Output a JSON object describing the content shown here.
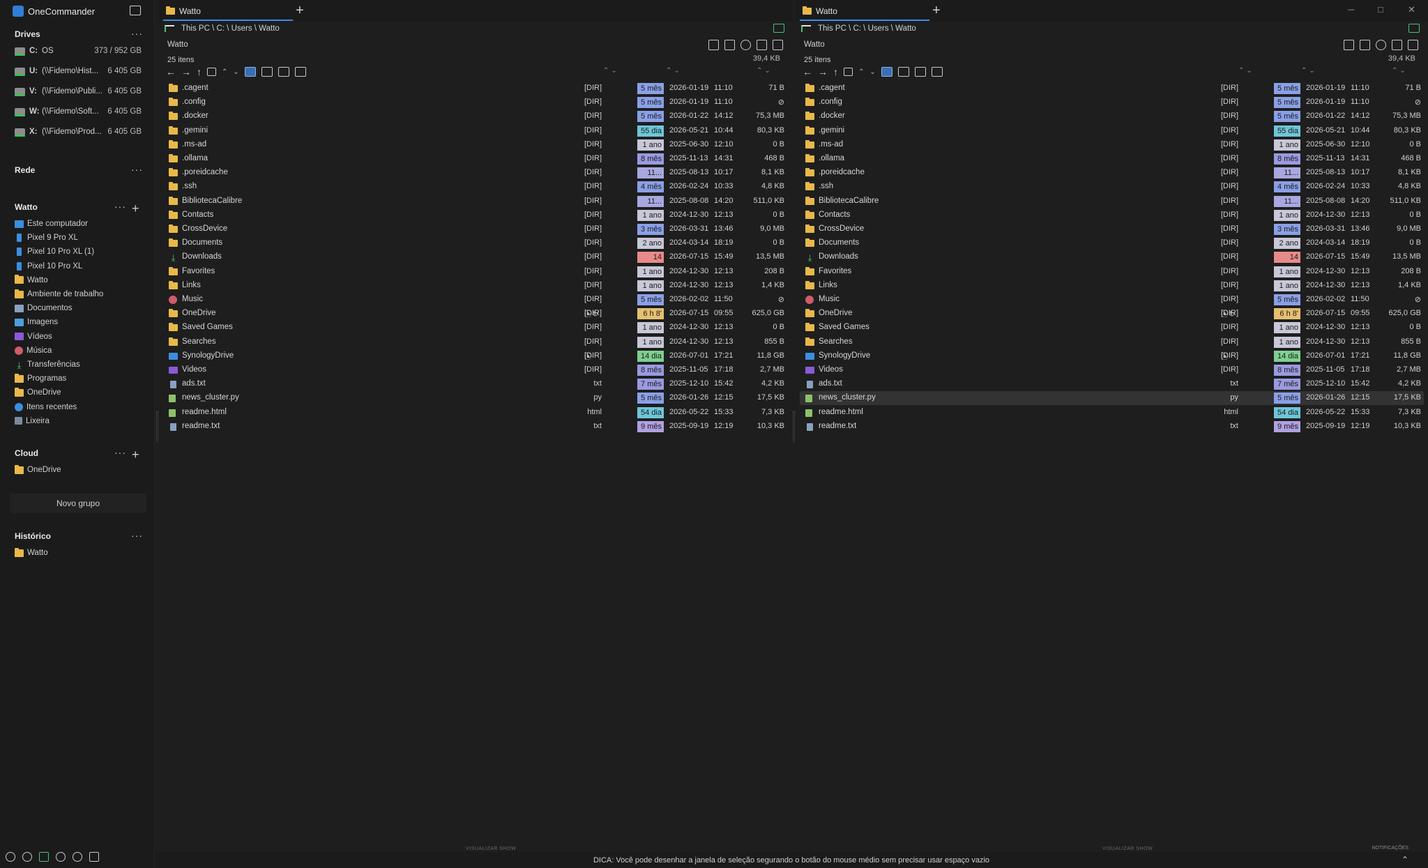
{
  "app": {
    "title": "OneCommander"
  },
  "sidebar": {
    "drives_title": "Drives",
    "drives": [
      {
        "letter": "C:",
        "name": "OS",
        "size": "373 / 952 GB"
      },
      {
        "letter": "U:",
        "name": "(\\\\Fidemo\\Hist...",
        "size": "6 405 GB"
      },
      {
        "letter": "V:",
        "name": "(\\\\Fidemo\\Publi...",
        "size": "6 405 GB"
      },
      {
        "letter": "W:",
        "name": "(\\\\Fidemo\\Soft...",
        "size": "6 405 GB"
      },
      {
        "letter": "X:",
        "name": "(\\\\Fidemo\\Prod...",
        "size": "6 405 GB"
      }
    ],
    "network_title": "Rede",
    "group_title": "Watto",
    "group_items": [
      {
        "label": "Este computador",
        "icon": "computer-icon"
      },
      {
        "label": "Pixel 9 Pro XL",
        "icon": "phone-icon"
      },
      {
        "label": "Pixel 10 Pro XL (1)",
        "icon": "phone-icon"
      },
      {
        "label": "Pixel 10 Pro XL",
        "icon": "phone-icon"
      },
      {
        "label": "Watto",
        "icon": "folder-icon"
      },
      {
        "label": "Ambiente de trabalho",
        "icon": "folder-icon"
      },
      {
        "label": "Documentos",
        "icon": "documents-icon"
      },
      {
        "label": "Imagens",
        "icon": "images-icon"
      },
      {
        "label": "Vídeos",
        "icon": "videos-icon"
      },
      {
        "label": "Música",
        "icon": "music-icon"
      },
      {
        "label": "Transferências",
        "icon": "download-icon"
      },
      {
        "label": "Programas",
        "icon": "folder-icon"
      },
      {
        "label": "OneDrive",
        "icon": "folder-icon"
      },
      {
        "label": "Itens recentes",
        "icon": "recent-icon"
      },
      {
        "label": "Lixeira",
        "icon": "trash-icon"
      }
    ],
    "cloud_title": "Cloud",
    "cloud_items": [
      {
        "label": "OneDrive"
      }
    ],
    "new_group": "Novo grupo",
    "history_title": "Histórico",
    "history_items": [
      {
        "label": "Watto"
      }
    ]
  },
  "panes": [
    {
      "tab": "Watto",
      "breadcrumb": "This PC  \\ C: \\ Users \\ Watto",
      "name": "Watto",
      "count": "25 itens",
      "total": "39,4 KB",
      "selected_index": -1
    },
    {
      "tab": "Watto",
      "breadcrumb": "This PC  \\ C: \\ Users \\ Watto",
      "name": "Watto",
      "count": "25 itens",
      "total": "39,4 KB",
      "selected_index": 22
    }
  ],
  "files": [
    {
      "name": ".cagent",
      "icon": "folder",
      "ext": "[DIR]",
      "age": "5 mês",
      "age_color": "#8aa0e6",
      "date": "2026-01-19",
      "time": "11:10",
      "size": "71 B",
      "sync": ""
    },
    {
      "name": ".config",
      "icon": "folder",
      "ext": "[DIR]",
      "age": "5 mês",
      "age_color": "#8aa0e6",
      "date": "2026-01-19",
      "time": "11:10",
      "size": "⊘",
      "sync": ""
    },
    {
      "name": ".docker",
      "icon": "folder",
      "ext": "[DIR]",
      "age": "5 mês",
      "age_color": "#8aa0e6",
      "date": "2026-01-22",
      "time": "14:12",
      "size": "75,3 MB",
      "sync": ""
    },
    {
      "name": ".gemini",
      "icon": "folder",
      "ext": "[DIR]",
      "age": "55 dia",
      "age_color": "#6ec6d8",
      "date": "2026-05-21",
      "time": "10:44",
      "size": "80,3 KB",
      "sync": ""
    },
    {
      "name": ".ms-ad",
      "icon": "folder",
      "ext": "[DIR]",
      "age": "1 ano",
      "age_color": "#c8c8d8",
      "date": "2025-06-30",
      "time": "12:10",
      "size": "0 B",
      "sync": ""
    },
    {
      "name": ".ollama",
      "icon": "folder",
      "ext": "[DIR]",
      "age": "8 mês",
      "age_color": "#9a9ae0",
      "date": "2025-11-13",
      "time": "14:31",
      "size": "468 B",
      "sync": ""
    },
    {
      "name": ".poreidcache",
      "icon": "folder",
      "ext": "[DIR]",
      "age": "11...",
      "age_color": "#a8a8e0",
      "date": "2025-08-13",
      "time": "10:17",
      "size": "8,1 KB",
      "sync": ""
    },
    {
      "name": ".ssh",
      "icon": "folder",
      "ext": "[DIR]",
      "age": "4 mês",
      "age_color": "#8aa0e6",
      "date": "2026-02-24",
      "time": "10:33",
      "size": "4,8 KB",
      "sync": ""
    },
    {
      "name": "BibliotecaCalibre",
      "icon": "folder",
      "ext": "[DIR]",
      "age": "11...",
      "age_color": "#a8a8e0",
      "date": "2025-08-08",
      "time": "14:20",
      "size": "511,0 KB",
      "sync": ""
    },
    {
      "name": "Contacts",
      "icon": "folder",
      "ext": "[DIR]",
      "age": "1 ano",
      "age_color": "#c8c8d8",
      "date": "2024-12-30",
      "time": "12:13",
      "size": "0 B",
      "sync": ""
    },
    {
      "name": "CrossDevice",
      "icon": "folder",
      "ext": "[DIR]",
      "age": "3 mês",
      "age_color": "#8aa0e6",
      "date": "2026-03-31",
      "time": "13:46",
      "size": "9,0 MB",
      "sync": ""
    },
    {
      "name": "Documents",
      "icon": "folder",
      "ext": "[DIR]",
      "age": "2 ano",
      "age_color": "#c8c8d8",
      "date": "2024-03-14",
      "time": "18:19",
      "size": "0 B",
      "sync": ""
    },
    {
      "name": "Downloads",
      "icon": "download",
      "ext": "[DIR]",
      "age": "14",
      "age_color": "#e88a8a",
      "date": "2026-07-15",
      "time": "15:49",
      "size": "13,5 MB",
      "sync": ""
    },
    {
      "name": "Favorites",
      "icon": "folder",
      "ext": "[DIR]",
      "age": "1 ano",
      "age_color": "#c8c8d8",
      "date": "2024-12-30",
      "time": "12:13",
      "size": "208 B",
      "sync": ""
    },
    {
      "name": "Links",
      "icon": "folder",
      "ext": "[DIR]",
      "age": "1 ano",
      "age_color": "#c8c8d8",
      "date": "2024-12-30",
      "time": "12:13",
      "size": "1,4 KB",
      "sync": ""
    },
    {
      "name": "Music",
      "icon": "music",
      "ext": "[DIR]",
      "age": "5 mês",
      "age_color": "#8aa0e6",
      "date": "2026-02-02",
      "time": "11:50",
      "size": "⊘",
      "sync": ""
    },
    {
      "name": "OneDrive",
      "icon": "folder",
      "ext": "[DIR]",
      "age": "6 h 8'",
      "age_color": "#e6c070",
      "date": "2026-07-15",
      "time": "09:55",
      "size": "625,0 GB",
      "sync": "⦿↻"
    },
    {
      "name": "Saved Games",
      "icon": "folder",
      "ext": "[DIR]",
      "age": "1 ano",
      "age_color": "#c8c8d8",
      "date": "2024-12-30",
      "time": "12:13",
      "size": "0 B",
      "sync": ""
    },
    {
      "name": "Searches",
      "icon": "folder",
      "ext": "[DIR]",
      "age": "1 ano",
      "age_color": "#c8c8d8",
      "date": "2024-12-30",
      "time": "12:13",
      "size": "855 B",
      "sync": ""
    },
    {
      "name": "SynologyDrive",
      "icon": "synology",
      "ext": "[DIR]",
      "age": "14 dia",
      "age_color": "#7ed090",
      "date": "2026-07-01",
      "time": "17:21",
      "size": "11,8 GB",
      "sync": "⦿"
    },
    {
      "name": "Videos",
      "icon": "video",
      "ext": "[DIR]",
      "age": "8 mês",
      "age_color": "#9a9ae0",
      "date": "2025-11-05",
      "time": "17:18",
      "size": "2,7 MB",
      "sync": ""
    },
    {
      "name": "ads.txt",
      "icon": "file",
      "ext": "txt",
      "age": "7 mês",
      "age_color": "#9a9ae0",
      "date": "2025-12-10",
      "time": "15:42",
      "size": "4,2 KB",
      "sync": ""
    },
    {
      "name": "news_cluster.py",
      "icon": "pyfile",
      "ext": "py",
      "age": "5 mês",
      "age_color": "#8aa0e6",
      "date": "2026-01-26",
      "time": "12:15",
      "size": "17,5 KB",
      "sync": ""
    },
    {
      "name": "readme.html",
      "icon": "htmlfile",
      "ext": "html",
      "age": "54 dia",
      "age_color": "#6ec6d8",
      "date": "2026-05-22",
      "time": "15:33",
      "size": "7,3 KB",
      "sync": ""
    },
    {
      "name": "readme.txt",
      "icon": "file",
      "ext": "txt",
      "age": "9 mês",
      "age_color": "#b0a0e0",
      "date": "2025-09-19",
      "time": "12:19",
      "size": "10,3 KB",
      "sync": ""
    }
  ],
  "bottom": {
    "show_label": "VISUALIZAR SHOW",
    "tip": "DICA: Você pode desenhar a janela de seleção segurando o botão do mouse médio sem precisar usar espaço vazio",
    "notifications": "NOTIFICAÇÕES"
  },
  "window_controls": {
    "minimize": "─",
    "maximize": "□",
    "close": "✕"
  }
}
